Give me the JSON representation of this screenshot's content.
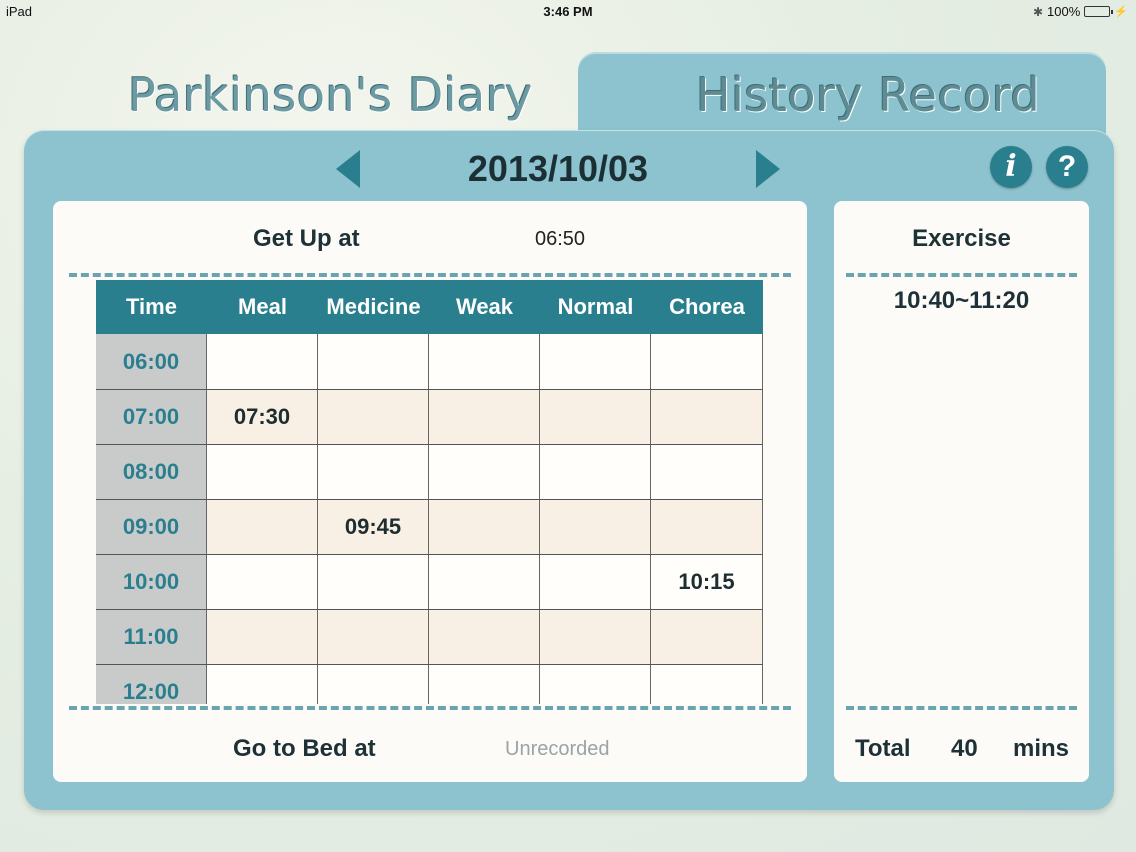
{
  "status_bar": {
    "device": "iPad",
    "time": "3:46 PM",
    "battery": "100%",
    "battery_level": 1.0
  },
  "tabs": {
    "diary": "Parkinson's Diary",
    "history": "History Record"
  },
  "date_nav": {
    "date": "2013/10/03"
  },
  "buttons": {
    "info": "i",
    "help": "?"
  },
  "main": {
    "get_up_label": "Get Up at",
    "get_up_value": "06:50",
    "bed_label": "Go to Bed at",
    "bed_value": "Unrecorded",
    "columns": [
      "Time",
      "Meal",
      "Medicine",
      "Weak",
      "Normal",
      "Chorea"
    ],
    "rows": [
      [
        "06:00",
        "",
        "",
        "",
        "",
        ""
      ],
      [
        "07:00",
        "07:30",
        "",
        "",
        "",
        ""
      ],
      [
        "08:00",
        "",
        "",
        "",
        "",
        ""
      ],
      [
        "09:00",
        "",
        "09:45",
        "",
        "",
        ""
      ],
      [
        "10:00",
        "",
        "",
        "",
        "",
        "10:15"
      ],
      [
        "11:00",
        "",
        "",
        "",
        "",
        ""
      ],
      [
        "12:00",
        "",
        "",
        "",
        "",
        ""
      ]
    ]
  },
  "exercise": {
    "title": "Exercise",
    "items": [
      "10:40~11:20"
    ],
    "total_label": "Total",
    "total_value": "40",
    "total_unit": "mins"
  },
  "colors": {
    "accent": "#2a7f8f",
    "panel": "#8cc3ce",
    "time_cell": "#c9cbcb",
    "row_alt": "#f8efe5"
  }
}
